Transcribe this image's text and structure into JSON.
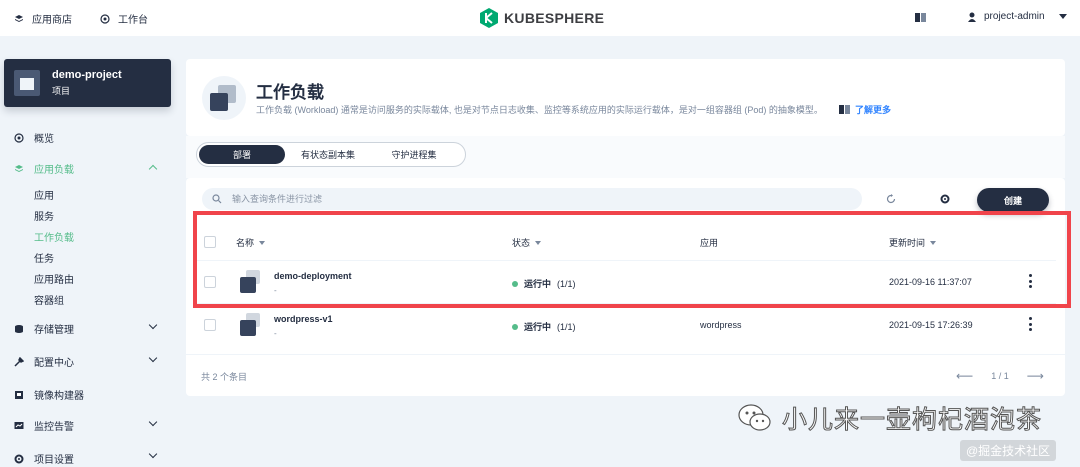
{
  "topbar": {
    "app_store": "应用商店",
    "workbench": "工作台",
    "logo_text": "KUBESPHERE",
    "user": "project-admin"
  },
  "project": {
    "name": "demo-project",
    "type": "项目"
  },
  "sidebar": {
    "overview": "概览",
    "app_workloads": "应用负载",
    "sub_items": [
      "应用",
      "服务",
      "工作负载",
      "任务",
      "应用路由",
      "容器组"
    ],
    "storage": "存储管理",
    "config": "配置中心",
    "image_builder": "镜像构建器",
    "monitoring": "监控告警",
    "project_settings": "项目设置"
  },
  "header": {
    "title": "工作负载",
    "description": "工作负载 (Workload) 通常是访问服务的实际载体, 也是对节点日志收集、监控等系统应用的实际运行载体，是对一组容器组 (Pod) 的抽象模型。",
    "learn_more": "了解更多"
  },
  "tabs": [
    "部署",
    "有状态副本集",
    "守护进程集"
  ],
  "toolbar": {
    "search_placeholder": "输入查询条件进行过滤",
    "create": "创建"
  },
  "table": {
    "columns": [
      "名称",
      "状态",
      "应用",
      "更新时间"
    ],
    "rows": [
      {
        "name": "demo-deployment",
        "sub": "-",
        "status": "运行中",
        "replicas": "(1/1)",
        "app": "",
        "updated": "2021-09-16 11:37:07"
      },
      {
        "name": "wordpress-v1",
        "sub": "-",
        "status": "运行中",
        "replicas": "(1/1)",
        "app": "wordpress",
        "updated": "2021-09-15 17:26:39"
      }
    ],
    "total": "共 2 个条目",
    "page": "1 / 1"
  },
  "watermark": {
    "text": "小儿来一壶枸杞酒泡茶",
    "site": "@掘金技术社区"
  },
  "colors": {
    "accent": "#55bc8a",
    "dark": "#242e42",
    "highlight": "#f0444b",
    "link": "#3385ff"
  }
}
